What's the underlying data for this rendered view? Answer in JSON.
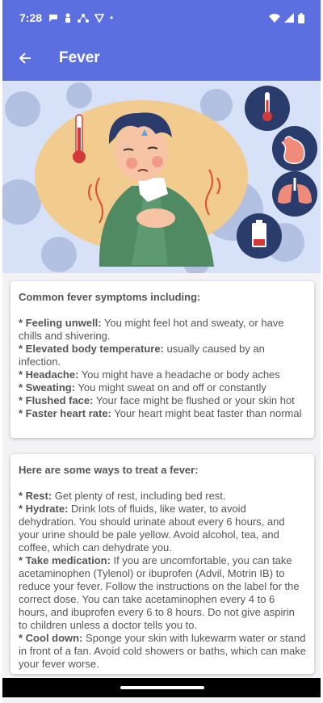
{
  "status": {
    "time": "7:28"
  },
  "appbar": {
    "title": "Fever"
  },
  "symptoms": {
    "heading": "Common fever symptoms including:",
    "items": [
      {
        "label": "* Feeling unwell:",
        "text": " You might feel hot and sweaty, or have chills and shivering."
      },
      {
        "label": "* Elevated body temperature:",
        "text": " usually caused by an infection."
      },
      {
        "label": "* Headache:",
        "text": " You might have a headache or body aches"
      },
      {
        "label": "* Sweating:",
        "text": " You might sweat on and off or constantly"
      },
      {
        "label": "* Flushed face:",
        "text": " Your face might be flushed or your skin hot"
      },
      {
        "label": "* Faster heart rate:",
        "text": " Your heart might beat faster than normal"
      }
    ]
  },
  "treatment": {
    "heading": "Here are some ways to treat a fever:",
    "items": [
      {
        "label": "* Rest:",
        "text": " Get plenty of rest, including bed rest."
      },
      {
        "label": "* Hydrate:",
        "text": " Drink lots of fluids, like water, to avoid dehydration. You should urinate about every 6 hours, and your urine should be pale yellow. Avoid alcohol, tea, and coffee, which can dehydrate you."
      },
      {
        "label": "* Take medication:",
        "text": " If you are uncomfortable, you can take acetaminophen (Tylenol) or ibuprofen (Advil, Motrin IB) to reduce your fever. Follow the instructions on the label for the correct dose. You can take acetaminophen every 4 to 6 hours, and ibuprofen every 6 to 8 hours. Do not give aspirin to children unless a doctor tells you to."
      },
      {
        "label": "* Cool down:",
        "text": " Sponge your skin with lukewarm water or stand in front of a fan. Avoid cold showers or baths, which can make your fever worse."
      }
    ]
  },
  "icons": [
    "back-arrow-icon",
    "thermometer-icon",
    "stomach-icon",
    "lungs-icon",
    "battery-low-icon",
    "wifi-icon",
    "signal-icon",
    "battery-icon"
  ],
  "colors": {
    "primary": "#5b6fe0",
    "hero_bg": "#d7e1f7"
  }
}
